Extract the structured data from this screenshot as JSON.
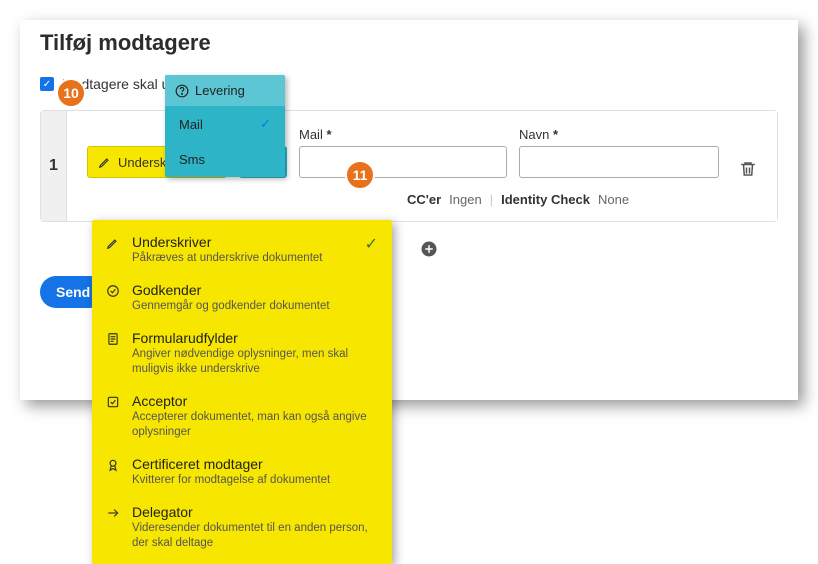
{
  "title": "Tilføj modtagere",
  "badges": {
    "b10": "10",
    "b11": "11"
  },
  "checkbox": {
    "label": "Modtagere skal un",
    "checked": true
  },
  "delivery": {
    "header": "Levering",
    "options": [
      "Mail",
      "Sms"
    ],
    "selected": "Mail"
  },
  "recipient": {
    "index": "1",
    "role_label": "Underskriver",
    "mail_label": "Mail",
    "navn_label": "Navn",
    "required_mark": "*",
    "cc_label": "CC'er",
    "cc_value": "Ingen",
    "identity_label": "Identity Check",
    "identity_value": "None"
  },
  "roles": [
    {
      "title": "Underskriver",
      "desc": "Påkræves at underskrive dokumentet",
      "selected": true
    },
    {
      "title": "Godkender",
      "desc": "Gennemgår og godkender dokumentet",
      "selected": false
    },
    {
      "title": "Formularudfylder",
      "desc": "Angiver nødvendige oplysninger, men skal muligvis ikke underskrive",
      "selected": false
    },
    {
      "title": "Acceptor",
      "desc": "Accepterer dokumentet, man kan også angive oplysninger",
      "selected": false
    },
    {
      "title": "Certificeret modtager",
      "desc": "Kvitterer for modtagelse af dokumentet",
      "selected": false
    },
    {
      "title": "Delegator",
      "desc": "Videresender dokumentet til en anden person, der skal deltage",
      "selected": false
    }
  ],
  "send_button": "Send"
}
